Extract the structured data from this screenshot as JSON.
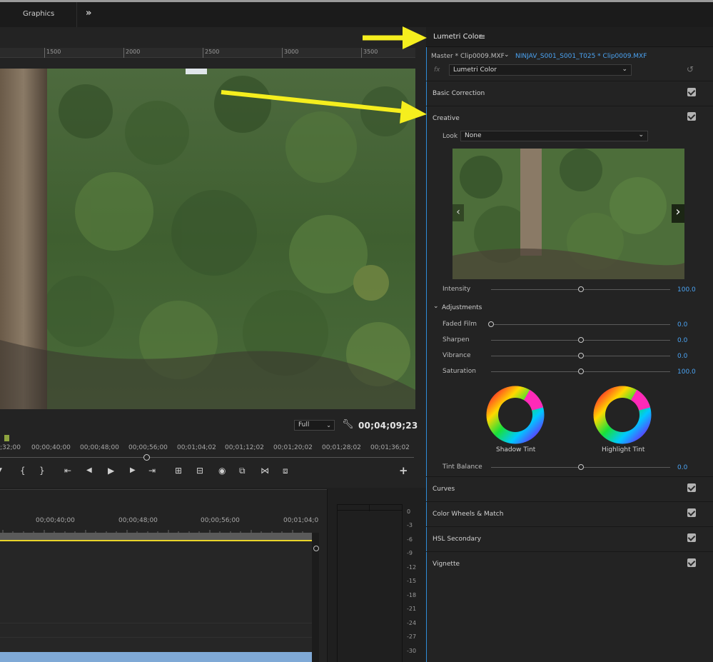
{
  "topbar": {
    "tab_label": "Graphics",
    "overflow": "»"
  },
  "monitor": {
    "ruler_labels": [
      "1500",
      "2000",
      "2500",
      "3000",
      "3500"
    ],
    "quality": "Full",
    "timecode": "00;04;09;23",
    "scrub_timecodes": [
      ";32;00",
      "00;00;40;00",
      "00;00;48;00",
      "00;00;56;00",
      "00;01;04;02",
      "00;01;12;02",
      "00;01;20;02",
      "00;01;28;02",
      "00;01;36;02"
    ],
    "transport_icons": [
      "mark-out-icon",
      "mark-in-icon",
      "mark-clip-icon",
      "go-to-in-icon",
      "step-back-icon",
      "play-icon",
      "step-forward-icon",
      "go-to-out-icon",
      "lift-icon",
      "extract-icon",
      "export-frame-icon",
      "comparison-view-icon",
      "trim-icon",
      "vr-video-icon",
      "add-button-icon"
    ],
    "transport_glyphs": [
      "▼",
      "{",
      "}",
      "⇤",
      "◀",
      "▶",
      "▶",
      "⇥",
      "⊞",
      "⊟",
      "◉",
      "⧉",
      "⋈",
      "⧈",
      "+"
    ]
  },
  "timeline": {
    "timecodes": [
      "00;00;40;00",
      "00;00;48;00",
      "00;00;56;00",
      "00;01;04;0"
    ]
  },
  "meters": {
    "db_labels": [
      "0",
      "-3",
      "-6",
      "-9",
      "-12",
      "-15",
      "-18",
      "-21",
      "-24",
      "-27",
      "-30"
    ]
  },
  "lumetri": {
    "title": "Lumetri Color",
    "menu_icon": "≡",
    "master_label": "Master * Clip0009.MXF",
    "sequence_link": "NINJAV_S001_S001_T025 * Clip0009.MXF",
    "fx_label": "fx",
    "effect_select": "Lumetri Color",
    "sections": {
      "basic_correction": "Basic Correction",
      "creative": "Creative",
      "curves": "Curves",
      "color_wheels": "Color Wheels & Match",
      "hsl_secondary": "HSL Secondary",
      "vignette": "Vignette"
    },
    "look_label": "Look",
    "look_value": "None",
    "intensity": {
      "label": "Intensity",
      "value": "100.0",
      "fraction": 0.5
    },
    "adjustments_label": "Adjustments",
    "faded_film": {
      "label": "Faded Film",
      "value": "0.0",
      "fraction": 0.0
    },
    "sharpen": {
      "label": "Sharpen",
      "value": "0.0",
      "fraction": 0.5
    },
    "vibrance": {
      "label": "Vibrance",
      "value": "0.0",
      "fraction": 0.5
    },
    "saturation": {
      "label": "Saturation",
      "value": "100.0",
      "fraction": 0.5
    },
    "shadow_tint": "Shadow Tint",
    "highlight_tint": "Highlight Tint",
    "tint_balance": {
      "label": "Tint Balance",
      "value": "0.0",
      "fraction": 0.5
    }
  },
  "colors": {
    "accent_blue": "#4ba3f2",
    "annotation_yellow": "#f5ee1e",
    "panel_border": "#2f8cd9"
  }
}
